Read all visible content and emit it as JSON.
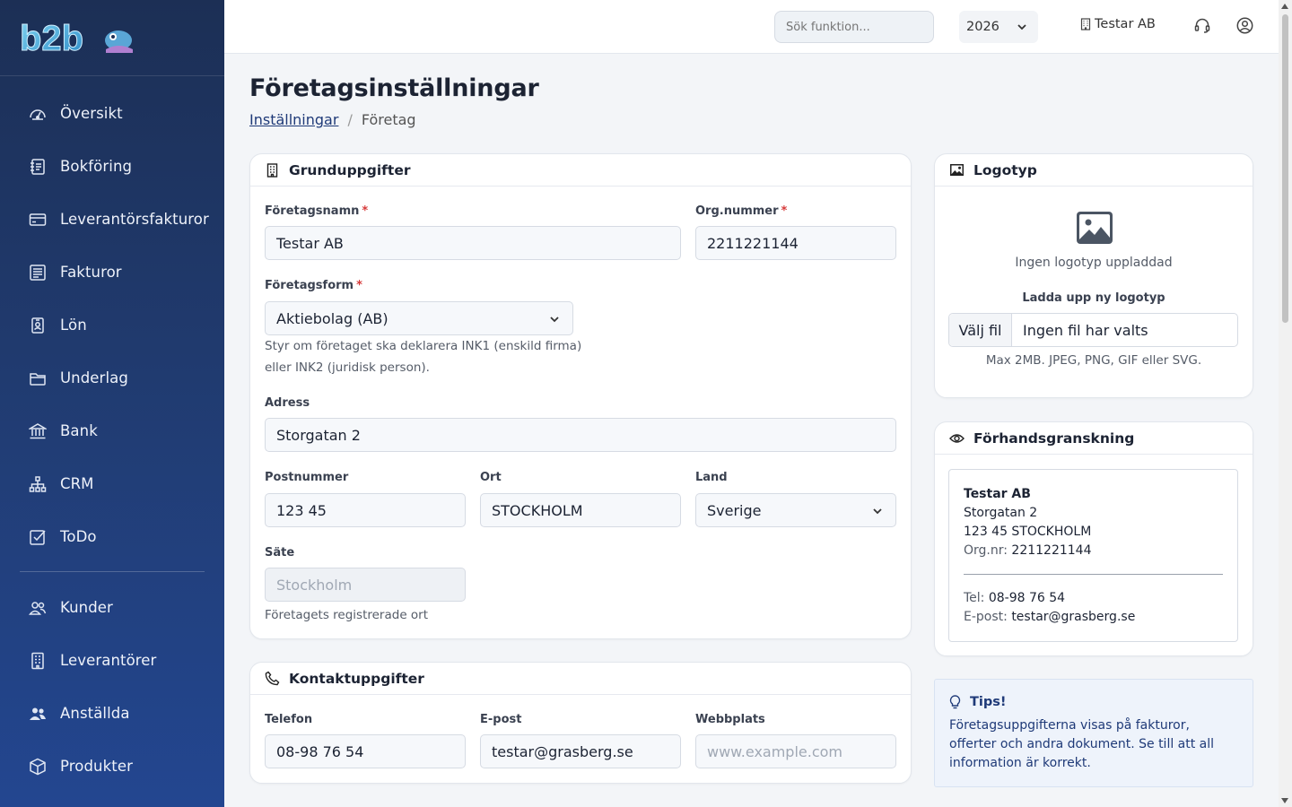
{
  "sidebar": {
    "logo_text": "b2b",
    "items": [
      {
        "label": "Översikt",
        "icon": "speedometer-icon"
      },
      {
        "label": "Bokföring",
        "icon": "journal-icon"
      },
      {
        "label": "Leverantörsfakturor",
        "icon": "credit-card-icon"
      },
      {
        "label": "Fakturor",
        "icon": "invoice-icon"
      },
      {
        "label": "Lön",
        "icon": "badge-icon"
      },
      {
        "label": "Underlag",
        "icon": "folder-icon"
      },
      {
        "label": "Bank",
        "icon": "bank-icon"
      },
      {
        "label": "CRM",
        "icon": "diagram-icon"
      },
      {
        "label": "ToDo",
        "icon": "checkbox-icon"
      }
    ],
    "items2": [
      {
        "label": "Kunder",
        "icon": "people-icon"
      },
      {
        "label": "Leverantörer",
        "icon": "building-icon"
      },
      {
        "label": "Anställda",
        "icon": "people-fill-icon"
      },
      {
        "label": "Produkter",
        "icon": "box-icon"
      }
    ]
  },
  "topbar": {
    "search_placeholder": "Sök funktion...",
    "year": "2026",
    "company": "Testar AB"
  },
  "page": {
    "title": "Företagsinställningar",
    "breadcrumb_link": "Inställningar",
    "breadcrumb_sep": "/",
    "breadcrumb_current": "Företag"
  },
  "basic": {
    "title": "Grunduppgifter",
    "company_name_label": "Företagsnamn",
    "company_name": "Testar AB",
    "org_label": "Org.nummer",
    "org_number": "2211221144",
    "required_mark": "*",
    "form_label": "Företagsform",
    "form_value": "Aktiebolag (AB)",
    "form_help_1": "Styr om företaget ska deklarera INK1 (enskild firma)",
    "form_help_2": "eller INK2 (juridisk person).",
    "address_label": "Adress",
    "address": "Storgatan 2",
    "postal_label": "Postnummer",
    "postal": "123 45",
    "city_label": "Ort",
    "city": "STOCKHOLM",
    "country_label": "Land",
    "country": "Sverige",
    "seat_label": "Säte",
    "seat_placeholder": "Stockholm",
    "seat_help": "Företagets registrerade ort"
  },
  "contact": {
    "title": "Kontaktuppgifter",
    "phone_label": "Telefon",
    "phone": "08-98 76 54",
    "email_label": "E-post",
    "email": "testar@grasberg.se",
    "website_label": "Webbplats",
    "website_placeholder": "www.example.com"
  },
  "logo_card": {
    "title": "Logotyp",
    "empty_text": "Ingen logotyp uppladdad",
    "upload_label": "Ladda upp ny logotyp",
    "choose_button": "Välj fil",
    "no_file": "Ingen fil har valts",
    "hint": "Max 2MB. JPEG, PNG, GIF eller SVG."
  },
  "preview": {
    "title": "Förhandsgranskning",
    "name": "Testar AB",
    "address": "Storgatan 2",
    "postal_city": "123 45 STOCKHOLM",
    "org_label": "Org.nr:",
    "org": "2211221144",
    "tel_label": "Tel:",
    "tel": "08-98 76 54",
    "email_label": "E-post:",
    "email": "testar@grasberg.se"
  },
  "tips": {
    "title": "Tips!",
    "body": "Företagsuppgifterna visas på fakturor, offerter och andra dokument. Se till att all information är korrekt."
  },
  "colors": {
    "sidebar_top": "#1c2f55",
    "sidebar_bottom": "#234690",
    "accent": "#1f3a78",
    "required": "#d63a3a"
  }
}
